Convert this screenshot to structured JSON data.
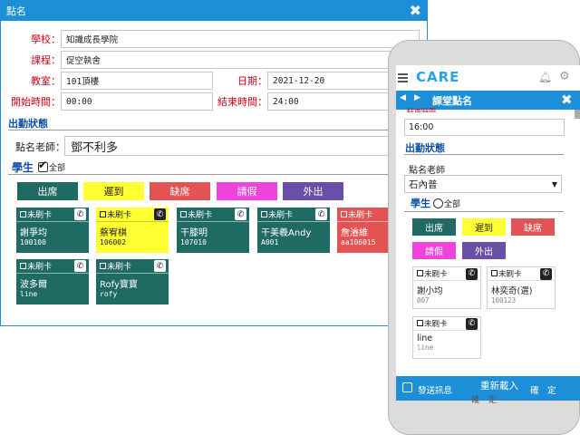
{
  "dialog": {
    "title": "點名",
    "school_label": "學校：",
    "school_value": "知識成長學院",
    "course_label": "課程：",
    "course_value": "促空執舍",
    "room_label": "教室：",
    "room_value": "101頂樓",
    "date_label": "日期：",
    "date_value": "2021-12-20",
    "start_label": "開始時間：",
    "start_value": "00:00",
    "end_label": "結束時間：",
    "end_value": "24:00",
    "attendance_title": "出勤狀態",
    "teacher_label": "點名老師：",
    "teacher_value": "鄧不利多",
    "students_label": "學生",
    "select_all_label": "全部",
    "status_buttons": [
      "出席",
      "遲到",
      "缺席",
      "請假",
      "外出"
    ],
    "cards": [
      {
        "tag": "未刷卡",
        "name": "謝爭均",
        "id": "100100",
        "color": "#1f6b63",
        "text": "#ffffff"
      },
      {
        "tag": "未刷卡",
        "name": "蔡宥棋",
        "id": "106002",
        "color": "#ffff33",
        "text": "#222222"
      },
      {
        "tag": "未刷卡",
        "name": "干膝明",
        "id": "107010",
        "color": "#1f6b63",
        "text": "#ffffff"
      },
      {
        "tag": "未刷卡",
        "name": "干美羲Andy",
        "id": "A001",
        "color": "#1f6b63",
        "text": "#ffffff"
      },
      {
        "tag": "未刷卡",
        "name": "詹濬維",
        "id": "aa106015",
        "color": "#e35353",
        "text": "#ffffff"
      },
      {
        "tag": "未刷卡",
        "name": "波多爾",
        "id": "line",
        "color": "#1f6b63",
        "text": "#ffffff"
      },
      {
        "tag": "未刷卡",
        "name": "Rofy寶寶",
        "id": "rofy",
        "color": "#1f6b63",
        "text": "#ffffff"
      }
    ]
  },
  "status_colors": [
    "#1f6b63",
    "#ffff33",
    "#e35353",
    "#ee44dd",
    "#6a4fa8"
  ],
  "mobile": {
    "brand": "CARE",
    "bar_title": "課堂點名",
    "partial_label": "結束時間",
    "time_value": "16:00",
    "attendance_title": "出勤狀態",
    "teacher_label": "點名老師",
    "teacher_value": "石內普",
    "students_label": "學生",
    "select_all_label": "全部",
    "status_buttons": [
      "出席",
      "遲到",
      "缺席",
      "請假",
      "外出"
    ],
    "cards": [
      {
        "tag": "未刷卡",
        "name": "謝小均",
        "id": "007"
      },
      {
        "tag": "未刷卡",
        "name": "林奕奇(選)",
        "id": "100123"
      },
      {
        "tag": "未刷卡",
        "name": "line",
        "id": "line"
      }
    ],
    "send_label": "發送訊息",
    "reload_label": "重新載入",
    "confirm_label": "確　定",
    "below_label": "確定"
  }
}
